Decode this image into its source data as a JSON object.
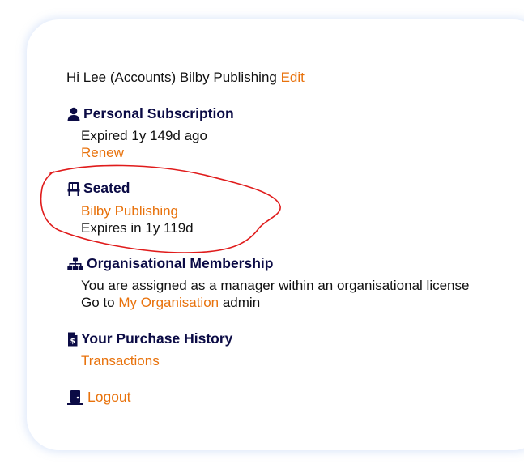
{
  "greeting": {
    "text": "Hi Lee (Accounts) Bilby Publishing",
    "edit_label": "Edit"
  },
  "personal": {
    "title": "Personal Subscription",
    "icon": "person-icon",
    "status": "Expired 1y 149d ago",
    "renew_label": "Renew"
  },
  "seated": {
    "title": "Seated",
    "icon": "chair-icon",
    "org_link": "Bilby Publishing",
    "expires": "Expires in 1y 119d"
  },
  "organisational": {
    "title": "Organisational Membership",
    "icon": "sitemap-icon",
    "line1": "You are assigned as a manager within an organisational license",
    "goto_prefix": "Go to",
    "goto_link": "My Organisation",
    "goto_suffix": "admin"
  },
  "purchase": {
    "title": "Your Purchase History",
    "icon": "invoice-dollar-icon",
    "transactions_label": "Transactions"
  },
  "logout": {
    "label": "Logout",
    "icon": "door-icon"
  },
  "colors": {
    "link": "#e8720c",
    "heading": "#0b0b45",
    "annotation": "#e01b1b"
  }
}
